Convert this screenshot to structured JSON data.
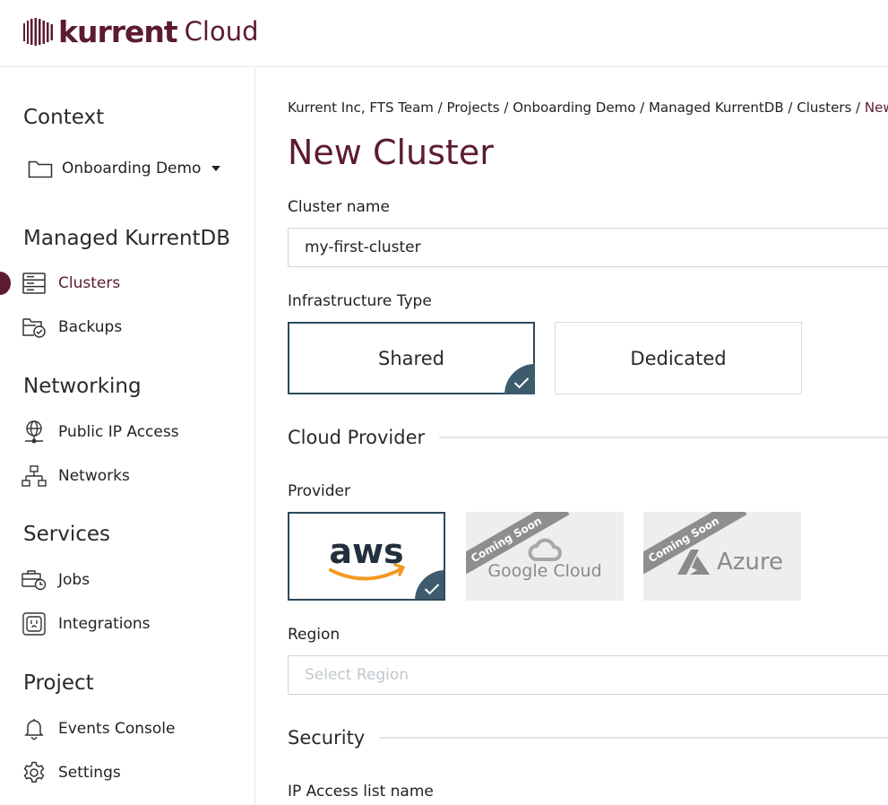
{
  "brand": {
    "word": "kurrent",
    "sub": "Cloud",
    "color": "#5c1b33"
  },
  "sidebar": {
    "context_title": "Context",
    "context_value": "Onboarding Demo",
    "sections": [
      {
        "title": "Managed KurrentDB"
      },
      {
        "title": "Networking"
      },
      {
        "title": "Services"
      },
      {
        "title": "Project"
      }
    ],
    "items": [
      {
        "label": "Clusters",
        "icon": "server-stack-icon",
        "active": true
      },
      {
        "label": "Backups",
        "icon": "backup-icon"
      },
      {
        "label": "Public IP Access",
        "icon": "globe-pin-icon"
      },
      {
        "label": "Networks",
        "icon": "network-tree-icon"
      },
      {
        "label": "Jobs",
        "icon": "briefcase-clock-icon"
      },
      {
        "label": "Integrations",
        "icon": "outlet-icon"
      },
      {
        "label": "Events Console",
        "icon": "bell-icon"
      },
      {
        "label": "Settings",
        "icon": "gear-icon"
      }
    ]
  },
  "main": {
    "breadcrumb": {
      "trail": "Kurrent Inc, FTS Team / Projects / Onboarding Demo / Managed KurrentDB / Clusters / ",
      "current": "New Cluster"
    },
    "title": "New Cluster",
    "cluster_name_label": "Cluster name",
    "cluster_name_value": "my-first-cluster",
    "infra_label": "Infrastructure Type",
    "infra_options": [
      {
        "label": "Shared",
        "selected": true
      },
      {
        "label": "Dedicated",
        "selected": false
      }
    ],
    "cloud_provider_title": "Cloud Provider",
    "provider_label": "Provider",
    "providers": [
      {
        "label": "aws",
        "selected": true,
        "coming_soon": false
      },
      {
        "label": "Google Cloud",
        "selected": false,
        "coming_soon": true
      },
      {
        "label": "Azure",
        "selected": false,
        "coming_soon": true
      }
    ],
    "coming_soon_text": "Coming Soon",
    "region_label": "Region",
    "region_placeholder": "Select Region",
    "security_title": "Security",
    "ip_access_label": "IP Access list name"
  },
  "colors": {
    "accent": "#5c1b33",
    "selected_border": "#2e4a5c",
    "check_bg": "#3d5b6d",
    "aws_orange": "#f29a1f"
  }
}
